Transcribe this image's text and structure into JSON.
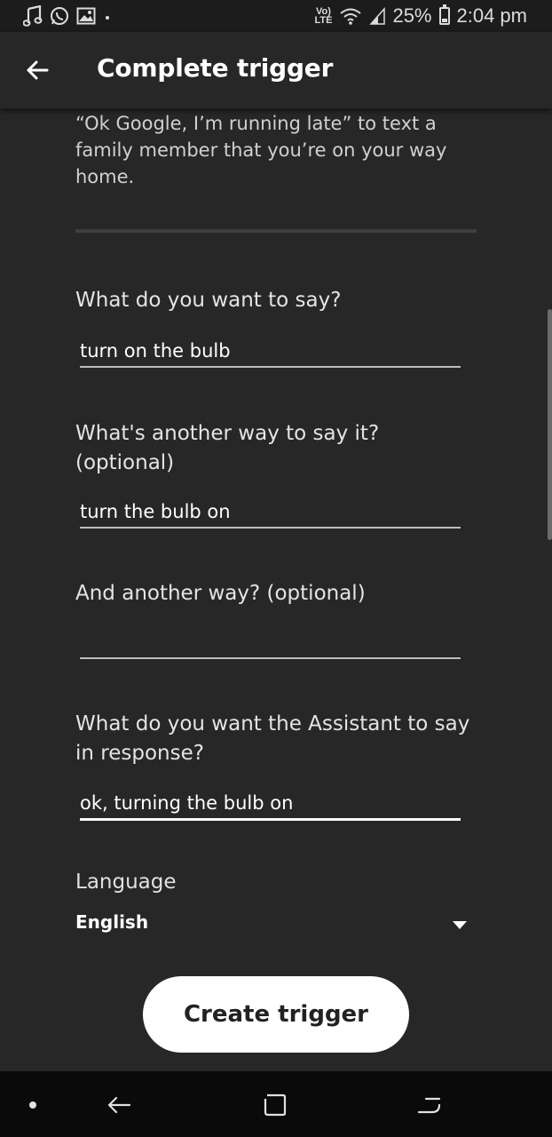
{
  "status_bar": {
    "time": "2:04 pm",
    "battery": "25%",
    "battery_level": 0.25,
    "network_top": "Vo)",
    "network_bottom": "LTE",
    "icons": [
      "music-note-icon",
      "whatsapp-icon",
      "image-icon",
      "dot-icon",
      "volte-icon",
      "wifi-icon",
      "signal-icon",
      "battery-icon"
    ]
  },
  "header": {
    "title": "Complete trigger",
    "back_icon": "arrow-left-icon"
  },
  "intro": {
    "text": "by a phrase you choose. For example, say “Ok Google, I’m running late” to text a family member that you’re on your way home."
  },
  "fields": [
    {
      "label": "What do you want to say?",
      "value": "turn on the bulb"
    },
    {
      "label": "What's another way to say it? (optional)",
      "value": "turn the bulb on"
    },
    {
      "label": "And another way? (optional)",
      "value": ""
    },
    {
      "label": "What do you want the Assistant to say in response?",
      "value": "ok, turning the bulb on"
    }
  ],
  "language": {
    "label": "Language",
    "value": "English",
    "icon": "dropdown-triangle-icon"
  },
  "cta": {
    "label": "Create trigger"
  },
  "nav_bar": {
    "icons": [
      "dot-icon",
      "back-arrow-icon",
      "recents-icon",
      "home-split-icon"
    ]
  },
  "colors": {
    "background": "#272727",
    "header": "#272727",
    "status_bar": "#1c1c1c",
    "nav_bar": "#0a0a0a",
    "button_bg": "#ffffff",
    "button_text": "#222222"
  }
}
